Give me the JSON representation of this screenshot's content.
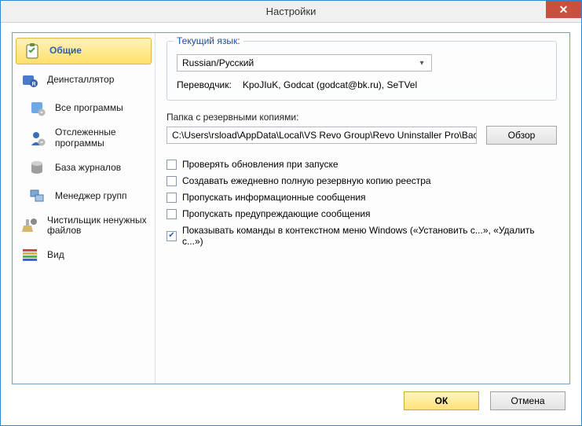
{
  "window": {
    "title": "Настройки"
  },
  "sidebar": {
    "items": [
      {
        "label": "Общие"
      },
      {
        "label": "Деинсталлятор"
      },
      {
        "label": "Все программы"
      },
      {
        "label": "Отслеженные программы"
      },
      {
        "label": "База журналов"
      },
      {
        "label": "Менеджер групп"
      },
      {
        "label": "Чистильщик ненужных файлов"
      },
      {
        "label": "Вид"
      }
    ]
  },
  "lang_group": {
    "legend": "Текущий язык:",
    "selected": "Russian/Русский",
    "translator_label": "Переводчик:",
    "translator_value": "KpoJIuK, Godcat (godcat@bk.ru), SeTVel"
  },
  "backup": {
    "label": "Папка с резервными копиями:",
    "path": "C:\\Users\\rsload\\AppData\\Local\\VS Revo Group\\Revo Uninstaller Pro\\BackUps",
    "browse": "Обзор"
  },
  "checks": [
    {
      "label": "Проверять обновления при запуске",
      "checked": false
    },
    {
      "label": "Создавать ежедневно полную резервную копию реестра",
      "checked": false
    },
    {
      "label": "Пропускать информационные сообщения",
      "checked": false
    },
    {
      "label": "Пропускать предупреждающие сообщения",
      "checked": false
    },
    {
      "label": "Показывать команды в контекстном меню Windows («Установить с...», «Удалить с...»)",
      "checked": true
    }
  ],
  "footer": {
    "ok": "ОК",
    "cancel": "Отмена"
  }
}
